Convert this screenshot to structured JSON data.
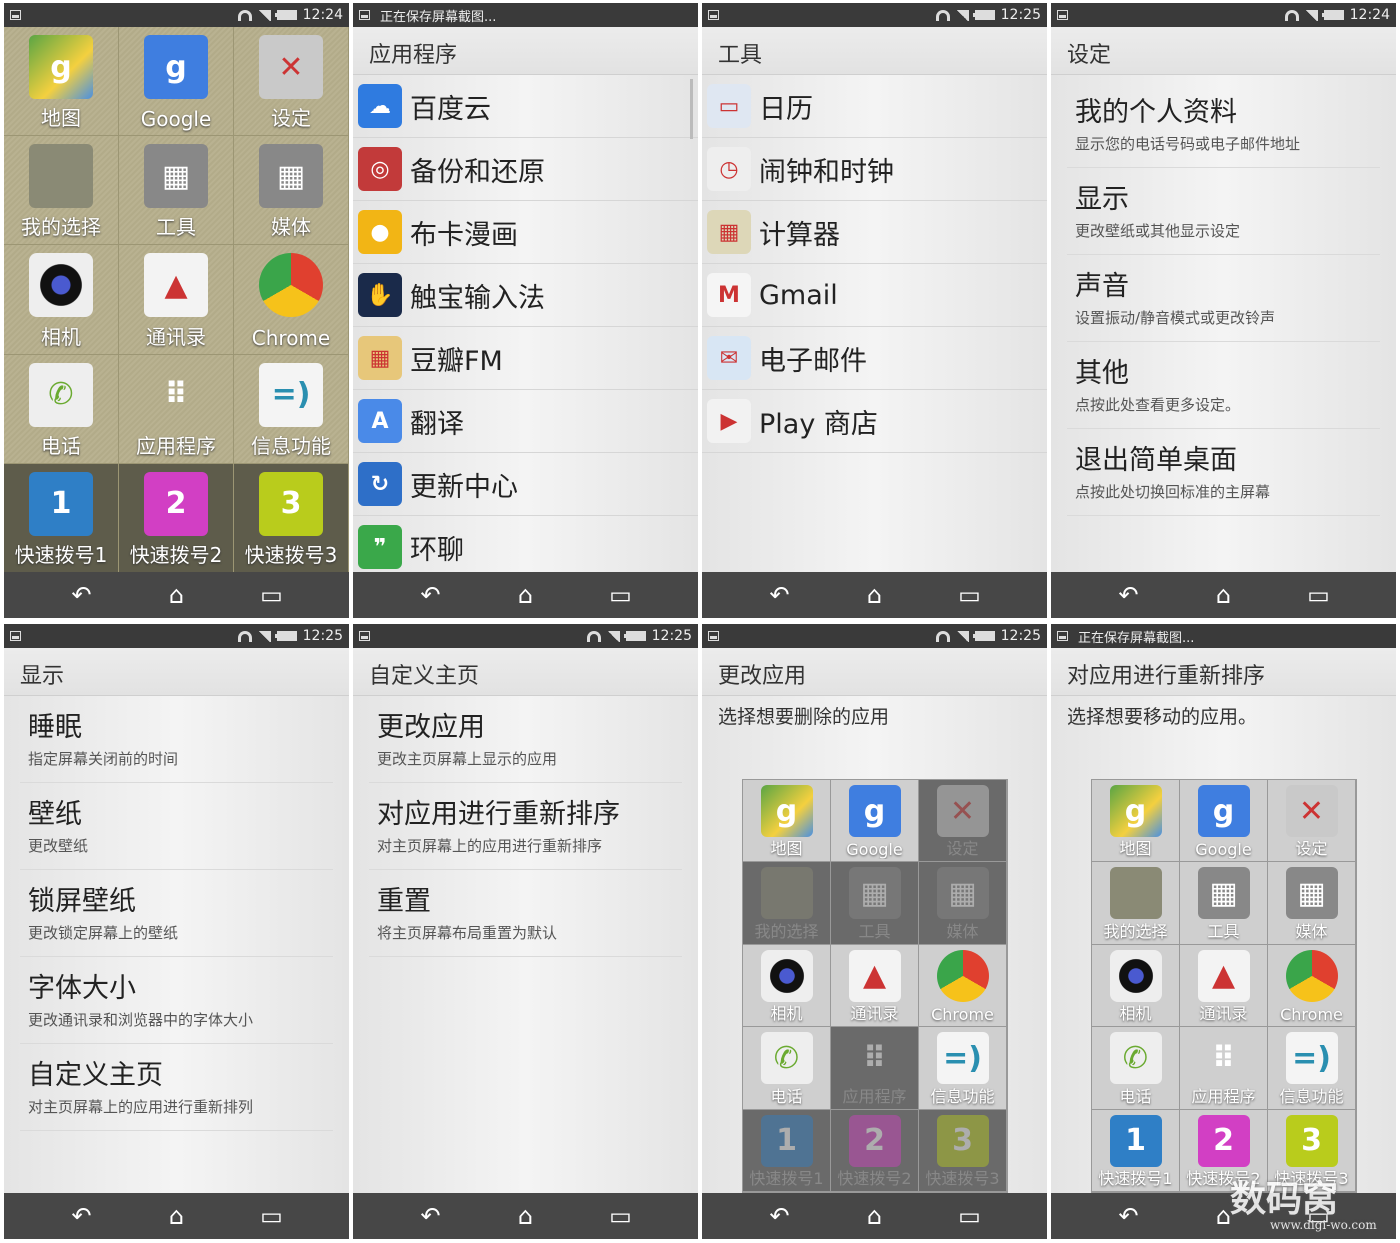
{
  "icons_colors": {
    "maps": "#5aa544",
    "google": "#3f7ee0",
    "settings": "#c9c9c9",
    "blank": "#8a8a75",
    "tools": "#888",
    "media": "#888",
    "camera": "#222",
    "contacts": "#f3f3f3",
    "chrome": "#e0402f",
    "phone": "#eeeeee",
    "apps": "transparent",
    "messaging": "#f4f4f4",
    "dial1": "#2f7fc6",
    "dial2": "#d23fc4",
    "dial3": "#b9cc1c"
  },
  "nav": {
    "back": "↶",
    "home": "⌂",
    "recent": "▭"
  },
  "panels": [
    {
      "status": {
        "notice": "",
        "time": "12:24"
      },
      "grid": [
        {
          "label": "地图",
          "icon": "maps",
          "glyph": "g"
        },
        {
          "label": "Google",
          "icon": "google",
          "glyph": "g"
        },
        {
          "label": "设定",
          "icon": "settings",
          "glyph": "✕"
        },
        {
          "label": "我的选择",
          "icon": "blank",
          "glyph": ""
        },
        {
          "label": "工具",
          "icon": "tools",
          "glyph": "▦"
        },
        {
          "label": "媒体",
          "icon": "media",
          "glyph": "▦"
        },
        {
          "label": "相机",
          "icon": "camera",
          "glyph": "◉"
        },
        {
          "label": "通讯录",
          "icon": "contacts",
          "glyph": "▲"
        },
        {
          "label": "Chrome",
          "icon": "chrome",
          "glyph": "●"
        },
        {
          "label": "电话",
          "icon": "phone",
          "glyph": "✆"
        },
        {
          "label": "应用程序",
          "icon": "apps",
          "glyph": "⠿"
        },
        {
          "label": "信息功能",
          "icon": "messaging",
          "glyph": "=)"
        },
        {
          "label": "快速拨号1",
          "icon": "dial1",
          "glyph": "1"
        },
        {
          "label": "快速拨号2",
          "icon": "dial2",
          "glyph": "2"
        },
        {
          "label": "快速拨号3",
          "icon": "dial3",
          "glyph": "3"
        }
      ]
    },
    {
      "status": {
        "notice": "正在保存屏幕截图...",
        "time": ""
      },
      "title": "应用程序",
      "items": [
        {
          "label": "百度云",
          "icon": "baidu-cloud",
          "color": "#2f7be0",
          "glyph": "☁"
        },
        {
          "label": "备份和还原",
          "icon": "backup",
          "color": "#c23a3a",
          "glyph": "◎"
        },
        {
          "label": "布卡漫画",
          "icon": "buka",
          "color": "#f2b515",
          "glyph": "●"
        },
        {
          "label": "触宝输入法",
          "icon": "touchpal",
          "color": "#1a2a4a",
          "glyph": "✋"
        },
        {
          "label": "豆瓣FM",
          "icon": "douban-fm",
          "color": "#e7c77a",
          "glyph": "▦"
        },
        {
          "label": "翻译",
          "icon": "translate",
          "color": "#4a8ae8",
          "glyph": "A"
        },
        {
          "label": "更新中心",
          "icon": "update",
          "color": "#2e6fc8",
          "glyph": "↻"
        },
        {
          "label": "环聊",
          "icon": "hangouts",
          "color": "#3aa84a",
          "glyph": "❞"
        }
      ]
    },
    {
      "status": {
        "notice": "",
        "time": "12:25"
      },
      "title": "工具",
      "items": [
        {
          "label": "日历",
          "icon": "calendar",
          "color": "#dfe7f2",
          "glyph": "▭"
        },
        {
          "label": "闹钟和时钟",
          "icon": "clock",
          "color": "#eeeeee",
          "glyph": "◷"
        },
        {
          "label": "计算器",
          "icon": "calculator",
          "color": "#ddd7b8",
          "glyph": "▦"
        },
        {
          "label": "Gmail",
          "icon": "gmail",
          "color": "#f5f5f5",
          "glyph": "M"
        },
        {
          "label": "电子邮件",
          "icon": "email",
          "color": "#d8e6f4",
          "glyph": "✉"
        },
        {
          "label": "Play 商店",
          "icon": "play-store",
          "color": "#f2f2f2",
          "glyph": "▶"
        }
      ]
    },
    {
      "status": {
        "notice": "",
        "time": "12:24"
      },
      "title": "设定",
      "items": [
        {
          "title": "我的个人资料",
          "sub": "显示您的电话号码或电子邮件地址"
        },
        {
          "title": "显示",
          "sub": "更改壁纸或其他显示设定"
        },
        {
          "title": "声音",
          "sub": "设置振动/静音模式或更改铃声"
        },
        {
          "title": "其他",
          "sub": "点按此处查看更多设定。"
        },
        {
          "title": "退出简单桌面",
          "sub": "点按此处切换回标准的主屏幕"
        }
      ]
    },
    {
      "status": {
        "notice": "",
        "time": "12:25"
      },
      "title": "显示",
      "items": [
        {
          "title": "睡眠",
          "sub": "指定屏幕关闭前的时间"
        },
        {
          "title": "壁纸",
          "sub": "更改壁纸"
        },
        {
          "title": "锁屏壁纸",
          "sub": "更改锁定屏幕上的壁纸"
        },
        {
          "title": "字体大小",
          "sub": "更改通讯录和浏览器中的字体大小"
        },
        {
          "title": "自定义主页",
          "sub": "对主页屏幕上的应用进行重新排列"
        }
      ]
    },
    {
      "status": {
        "notice": "",
        "time": "12:25"
      },
      "title": "自定义主页",
      "items": [
        {
          "title": "更改应用",
          "sub": "更改主页屏幕上显示的应用"
        },
        {
          "title": "对应用进行重新排序",
          "sub": "对主页屏幕上的应用进行重新排序"
        },
        {
          "title": "重置",
          "sub": "将主页屏幕布局重置为默认"
        }
      ]
    },
    {
      "status": {
        "notice": "",
        "time": "12:25"
      },
      "title": "更改应用",
      "description": "选择想要删除的应用",
      "dimmed": [
        "设定",
        "我的选择",
        "工具",
        "媒体",
        "应用程序",
        "快速拨号1",
        "快速拨号2",
        "快速拨号3"
      ]
    },
    {
      "status": {
        "notice": "正在保存屏幕截图...",
        "time": ""
      },
      "title": "对应用进行重新排序",
      "description": "选择想要移动的应用。",
      "dimmed": []
    }
  ],
  "watermark": {
    "name": "数码窝",
    "url": "www.digi-wo.com"
  }
}
